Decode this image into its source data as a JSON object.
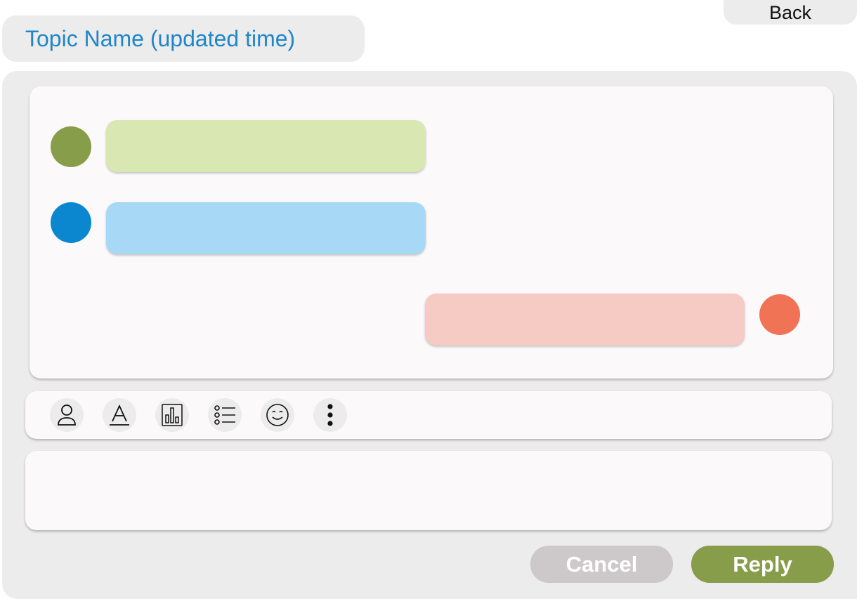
{
  "header": {
    "back_label": "Back",
    "topic_title": "Topic Name (updated time)"
  },
  "messages": [
    {
      "side": "left",
      "avatar_color": "#879d4a",
      "bubble_color": "#d9e7b2",
      "text": ""
    },
    {
      "side": "left",
      "avatar_color": "#0a87cf",
      "bubble_color": "#a7d9f6",
      "text": ""
    },
    {
      "side": "right",
      "avatar_color": "#f07356",
      "bubble_color": "#f6cbc3",
      "text": ""
    }
  ],
  "toolbar": {
    "tools": [
      {
        "icon": "person-icon"
      },
      {
        "icon": "text-format-icon"
      },
      {
        "icon": "bar-chart-icon"
      },
      {
        "icon": "list-icon"
      },
      {
        "icon": "emoji-icon"
      },
      {
        "icon": "more-vertical-icon"
      }
    ]
  },
  "reply_box": {
    "value": "",
    "placeholder": ""
  },
  "actions": {
    "cancel_label": "Cancel",
    "reply_label": "Reply"
  },
  "colors": {
    "accent_blue": "#1f86c8",
    "reply_green": "#879d4a",
    "cancel_gray": "#cdc8c9",
    "panel_gray": "#ececec"
  }
}
